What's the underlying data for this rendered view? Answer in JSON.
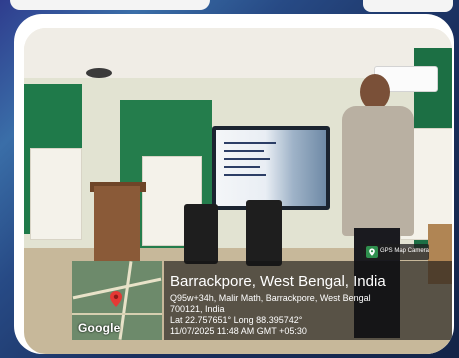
{
  "location": {
    "title": "Barrackpore, West Bengal, India",
    "address_line1": "Q95w+34h, Malir Math, Barrackpore, West Bengal",
    "address_line2": "700121, India",
    "coordinates": "Lat 22.757651° Long 88.395742°",
    "datetime": "11/07/2025 11:48 AM GMT +05:30"
  },
  "map": {
    "logo": "Google",
    "icon": "map-pin-icon"
  },
  "badge": {
    "label": "GPS Map Camera",
    "icon": "camera-map-icon"
  },
  "colors": {
    "frame_border": "#ffffff",
    "overlay_bg": "#141414",
    "pin": "#e53935",
    "wall_green": "#1f7a4a"
  }
}
